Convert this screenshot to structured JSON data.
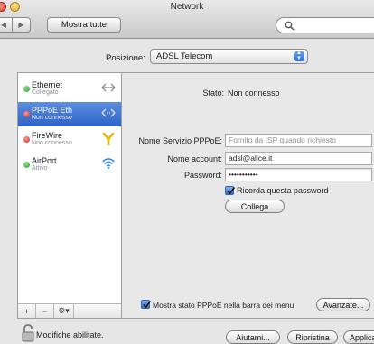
{
  "window": {
    "title": "Network"
  },
  "toolbar": {
    "back_glyph": "◀",
    "forward_glyph": "▶",
    "show_all_label": "Mostra tutte",
    "search_placeholder": ""
  },
  "location": {
    "label": "Posizione:",
    "selected": "ADSL Telecom"
  },
  "services": [
    {
      "name": "Ethernet",
      "status": "Collegato",
      "status_color": "#2f9b2f",
      "icon": "ethernet-arrows-icon",
      "selected": false
    },
    {
      "name": "PPPoE Eth",
      "status": "Non connesso",
      "status_color": "#c92c22",
      "icon": "ethernet-arrows-icon",
      "selected": true
    },
    {
      "name": "FireWire",
      "status": "Non connesso",
      "status_color": "#c92c22",
      "icon": "firewire-icon",
      "selected": false
    },
    {
      "name": "AirPort",
      "status": "Attivo",
      "status_color": "#2f9b2f",
      "icon": "wifi-icon",
      "selected": false
    }
  ],
  "sidebar_buttons": {
    "add": "+",
    "remove": "−",
    "action": "⚙▾"
  },
  "detail": {
    "status_label": "Stato:",
    "status_value": "Non connesso",
    "service_name_label": "Nome Servizio PPPoE:",
    "service_name_placeholder": "Fornito da ISP quando richiesto",
    "account_label": "Nome account:",
    "account_value": "adsl@alice.it",
    "password_label": "Password:",
    "password_value": "•••••••••••",
    "remember_label": "Ricorda questa password",
    "remember_checked": true,
    "connect_button": "Collega",
    "show_status_label": "Mostra stato PPPoE nella barra dei menu",
    "show_status_checked": true,
    "advanced_button": "Avanzate..."
  },
  "footer": {
    "lock_text": "Modifiche abilitate.",
    "help_button": "Aiutami...",
    "revert_button": "Ripristina",
    "apply_button": "Applica"
  },
  "colors": {
    "selection": "#2e63c7",
    "accent": "#2d6fd4"
  }
}
